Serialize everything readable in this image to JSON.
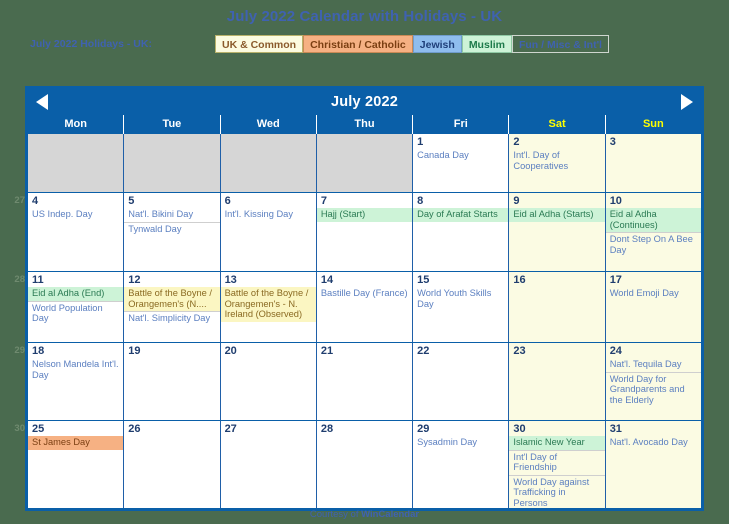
{
  "header": {
    "title": "July 2022 Calendar with Holidays - UK",
    "subtitle": "July 2022 Holidays - UK:"
  },
  "legend": {
    "items": [
      {
        "label": "UK & Common",
        "key": "uk"
      },
      {
        "label": "Christian / Catholic",
        "key": "christian"
      },
      {
        "label": "Jewish",
        "key": "jewish"
      },
      {
        "label": "Muslim",
        "key": "muslim"
      },
      {
        "label": "Fun / Misc & Int'l",
        "key": "fun"
      }
    ]
  },
  "calendar": {
    "month_title": "July 2022",
    "prev_label": "◀",
    "next_label": "▶",
    "weekdays": [
      "Mon",
      "Tue",
      "Wed",
      "Thu",
      "Fri",
      "Sat",
      "Sun"
    ],
    "week_numbers": [
      "27",
      "28",
      "29",
      "30"
    ],
    "weeks": [
      {
        "days": [
          {
            "num": "",
            "blank": true,
            "events": []
          },
          {
            "num": "",
            "blank": true,
            "events": []
          },
          {
            "num": "",
            "blank": true,
            "events": []
          },
          {
            "num": "",
            "blank": true,
            "events": []
          },
          {
            "num": "1",
            "events": [
              {
                "text": "Canada Day",
                "cat": "fun"
              }
            ]
          },
          {
            "num": "2",
            "weekend": true,
            "events": [
              {
                "text": "Int'l. Day of Cooperatives",
                "cat": "fun"
              }
            ]
          },
          {
            "num": "3",
            "weekend": true,
            "events": []
          }
        ]
      },
      {
        "days": [
          {
            "num": "4",
            "events": [
              {
                "text": "US Indep. Day",
                "cat": "fun"
              }
            ]
          },
          {
            "num": "5",
            "events": [
              {
                "text": "Nat'l. Bikini Day",
                "cat": "fun"
              },
              {
                "text": "Tynwald Day",
                "cat": "fun"
              }
            ]
          },
          {
            "num": "6",
            "events": [
              {
                "text": "Int'l. Kissing Day",
                "cat": "fun"
              }
            ]
          },
          {
            "num": "7",
            "events": [
              {
                "text": "Hajj (Start)",
                "cat": "muslim"
              }
            ]
          },
          {
            "num": "8",
            "events": [
              {
                "text": "Day of Arafat Starts",
                "cat": "muslim"
              }
            ]
          },
          {
            "num": "9",
            "weekend": true,
            "events": [
              {
                "text": "Eid al Adha (Starts)",
                "cat": "muslim",
                "nowrap": true
              }
            ]
          },
          {
            "num": "10",
            "weekend": true,
            "events": [
              {
                "text": "Eid al Adha (Continues)",
                "cat": "muslim"
              },
              {
                "text": "Dont Step On A Bee Day",
                "cat": "fun"
              }
            ]
          }
        ]
      },
      {
        "days": [
          {
            "num": "11",
            "events": [
              {
                "text": "Eid al Adha (End)",
                "cat": "muslim"
              },
              {
                "text": "World Population Day",
                "cat": "fun"
              }
            ]
          },
          {
            "num": "12",
            "events": [
              {
                "text": "Battle of the Boyne / Orangemen's (N....",
                "cat": "uk"
              },
              {
                "text": "Nat'l. Simplicity Day",
                "cat": "fun"
              }
            ]
          },
          {
            "num": "13",
            "events": [
              {
                "text": "Battle of the Boyne / Orangemen's - N. Ireland (Observed)",
                "cat": "uk"
              }
            ]
          },
          {
            "num": "14",
            "events": [
              {
                "text": "Bastille Day (France)",
                "cat": "fun",
                "nowrap": true
              }
            ]
          },
          {
            "num": "15",
            "events": [
              {
                "text": "World Youth Skills Day",
                "cat": "fun"
              }
            ]
          },
          {
            "num": "16",
            "weekend": true,
            "events": []
          },
          {
            "num": "17",
            "weekend": true,
            "events": [
              {
                "text": "World Emoji Day",
                "cat": "fun"
              }
            ]
          }
        ]
      },
      {
        "days": [
          {
            "num": "18",
            "events": [
              {
                "text": "Nelson Mandela Int'l. Day",
                "cat": "fun"
              }
            ]
          },
          {
            "num": "19",
            "events": []
          },
          {
            "num": "20",
            "events": []
          },
          {
            "num": "21",
            "events": []
          },
          {
            "num": "22",
            "events": []
          },
          {
            "num": "23",
            "weekend": true,
            "events": []
          },
          {
            "num": "24",
            "weekend": true,
            "events": [
              {
                "text": "Nat'l. Tequila Day",
                "cat": "fun"
              },
              {
                "text": "World Day for Grandparents and the Elderly",
                "cat": "fun"
              }
            ]
          }
        ]
      },
      {
        "days": [
          {
            "num": "25",
            "events": [
              {
                "text": "St James Day",
                "cat": "christian"
              }
            ]
          },
          {
            "num": "26",
            "events": []
          },
          {
            "num": "27",
            "events": []
          },
          {
            "num": "28",
            "events": []
          },
          {
            "num": "29",
            "events": [
              {
                "text": "Sysadmin Day",
                "cat": "fun"
              }
            ]
          },
          {
            "num": "30",
            "weekend": true,
            "events": [
              {
                "text": "Islamic New Year",
                "cat": "muslim"
              },
              {
                "text": "Int'l Day of Friendship",
                "cat": "fun"
              },
              {
                "text": "World Day against Trafficking in Persons",
                "cat": "fun"
              }
            ]
          },
          {
            "num": "31",
            "weekend": true,
            "events": [
              {
                "text": "Nat'l. Avocado Day",
                "cat": "fun"
              }
            ]
          }
        ]
      }
    ]
  },
  "footer": {
    "prefix": "Courtesy of ",
    "brand": "WinCalendar"
  },
  "colors": {
    "page_background": "#4a6b4f",
    "accent_blue": "#0a5fa8",
    "title_blue": "#3f62b0",
    "weekend_yellow": "#ffff00",
    "cat_uk": "#fbf6c2",
    "cat_christian": "#f6b183",
    "cat_jewish": "#8fbdee",
    "cat_muslim": "#cdf3d7",
    "weekend_cell": "#fbfbe3",
    "blank_cell": "#d6d6d6"
  }
}
